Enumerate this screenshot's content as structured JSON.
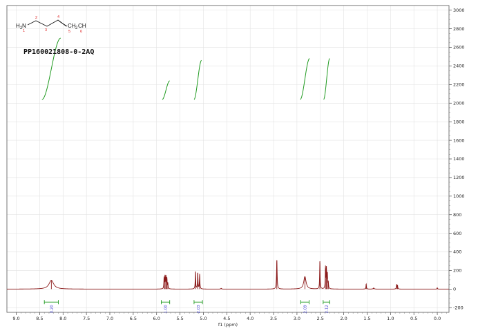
{
  "chart_data": {
    "type": "line",
    "title": "",
    "sample_id": "PP160021808-0-2AQ",
    "xlabel": "f1 (ppm)",
    "ylabel": "",
    "xlim": [
      9.2,
      -0.25
    ],
    "ylim": [
      -250,
      3050
    ],
    "x_reversed": true,
    "grid": true,
    "x_ticks": [
      9.0,
      8.5,
      8.0,
      7.5,
      7.0,
      6.5,
      6.0,
      5.5,
      5.0,
      4.5,
      4.0,
      3.5,
      3.0,
      2.5,
      2.0,
      1.5,
      1.0,
      0.5,
      0.0
    ],
    "x_tick_labels": [
      "9.0",
      "8.5",
      "8.0",
      "7.5",
      "7.0",
      "6.5",
      "6.0",
      "5.5",
      "5.0",
      "4.5",
      "4.0",
      "3.5",
      "3.0",
      "2.5",
      "2.0",
      "1.5",
      "1.0",
      "0.5",
      "0.0"
    ],
    "y_ticks": [
      -200,
      0,
      200,
      400,
      600,
      800,
      1000,
      1200,
      1400,
      1600,
      1800,
      2000,
      2200,
      2400,
      2600,
      2800,
      3000
    ],
    "y_tick_labels": [
      "-200",
      "0",
      "200",
      "400",
      "600",
      "800",
      "1000",
      "1200",
      "1400",
      "1600",
      "1800",
      "2000",
      "2200",
      "2400",
      "2600",
      "2800",
      "3000"
    ],
    "spectrum_color": "#8b1a1a",
    "integral_color": "#1f9a1f",
    "peaks": [
      {
        "ppm": 8.25,
        "height": 95,
        "width": 0.06
      },
      {
        "ppm": 5.84,
        "height": 120,
        "width": 0.006
      },
      {
        "ppm": 5.82,
        "height": 135,
        "width": 0.006
      },
      {
        "ppm": 5.8,
        "height": 130,
        "width": 0.006
      },
      {
        "ppm": 5.78,
        "height": 110,
        "width": 0.006
      },
      {
        "ppm": 5.76,
        "height": 60,
        "width": 0.006
      },
      {
        "ppm": 5.17,
        "height": 190,
        "width": 0.006
      },
      {
        "ppm": 5.12,
        "height": 175,
        "width": 0.006
      },
      {
        "ppm": 5.08,
        "height": 160,
        "width": 0.006
      },
      {
        "ppm": 4.62,
        "height": 8,
        "width": 0.01
      },
      {
        "ppm": 3.43,
        "height": 310,
        "width": 0.008
      },
      {
        "ppm": 2.83,
        "height": 135,
        "width": 0.03
      },
      {
        "ppm": 2.51,
        "height": 300,
        "width": 0.006
      },
      {
        "ppm": 2.39,
        "height": 230,
        "width": 0.006
      },
      {
        "ppm": 2.37,
        "height": 215,
        "width": 0.006
      },
      {
        "ppm": 2.35,
        "height": 160,
        "width": 0.006
      },
      {
        "ppm": 2.33,
        "height": 70,
        "width": 0.006
      },
      {
        "ppm": 1.52,
        "height": 55,
        "width": 0.006
      },
      {
        "ppm": 1.36,
        "height": 12,
        "width": 0.012
      },
      {
        "ppm": 0.87,
        "height": 50,
        "width": 0.006
      },
      {
        "ppm": 0.85,
        "height": 40,
        "width": 0.006
      },
      {
        "ppm": 0.0,
        "height": 15,
        "width": 0.006
      }
    ],
    "integral_curves": [
      {
        "start_ppm": 8.45,
        "end_ppm": 8.05,
        "y_start": 2040,
        "y_end": 2700
      },
      {
        "start_ppm": 5.88,
        "end_ppm": 5.72,
        "y_start": 2040,
        "y_end": 2240
      },
      {
        "start_ppm": 5.2,
        "end_ppm": 5.04,
        "y_start": 2040,
        "y_end": 2460
      },
      {
        "start_ppm": 2.93,
        "end_ppm": 2.73,
        "y_start": 2040,
        "y_end": 2480
      },
      {
        "start_ppm": 2.43,
        "end_ppm": 2.3,
        "y_start": 2040,
        "y_end": 2480
      }
    ],
    "integrals": [
      {
        "from_ppm": 8.4,
        "to_ppm": 8.1,
        "label": "3.20"
      },
      {
        "from_ppm": 5.9,
        "to_ppm": 5.72,
        "label": "1.00"
      },
      {
        "from_ppm": 5.2,
        "to_ppm": 5.02,
        "label": "2.03"
      },
      {
        "from_ppm": 2.92,
        "to_ppm": 2.74,
        "label": "2.09"
      },
      {
        "from_ppm": 2.44,
        "to_ppm": 2.3,
        "label": "2.12"
      }
    ]
  },
  "molecule": {
    "parts": [
      "H",
      "2",
      "N",
      "CH",
      "2",
      "CH"
    ],
    "locants": [
      "1",
      "2",
      "3",
      "4",
      "5",
      "6"
    ]
  }
}
